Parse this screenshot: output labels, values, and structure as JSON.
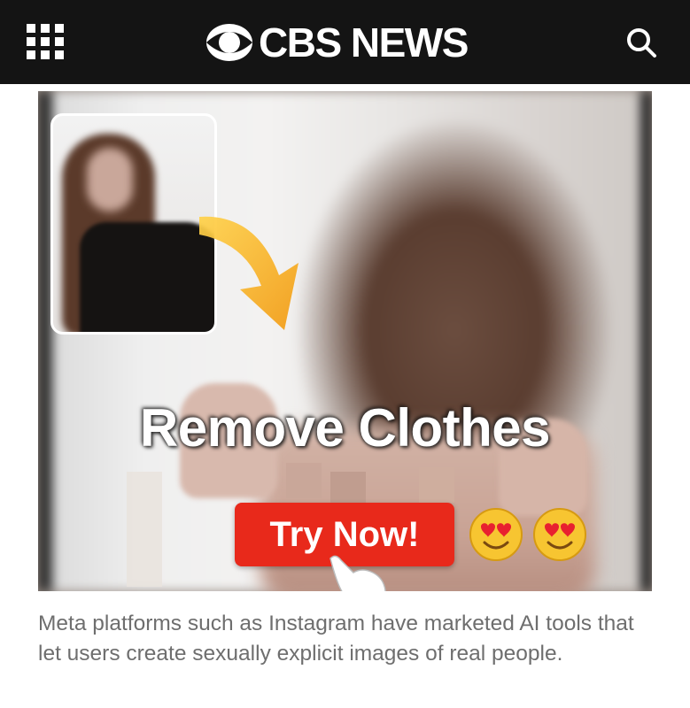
{
  "header": {
    "logo_text": "CBS NEWS",
    "menu_icon": "grid-menu-icon",
    "search_icon": "search-icon",
    "background": "#141414"
  },
  "article": {
    "image": {
      "headline": "Remove Clothes",
      "cta_label": "Try Now!",
      "emojis": [
        "heart-eyes-emoji",
        "heart-eyes-emoji"
      ],
      "cta_color": "#e8291b"
    },
    "caption": "Meta platforms such as Instagram have marketed AI tools that let users create sexually explicit images of real people."
  }
}
